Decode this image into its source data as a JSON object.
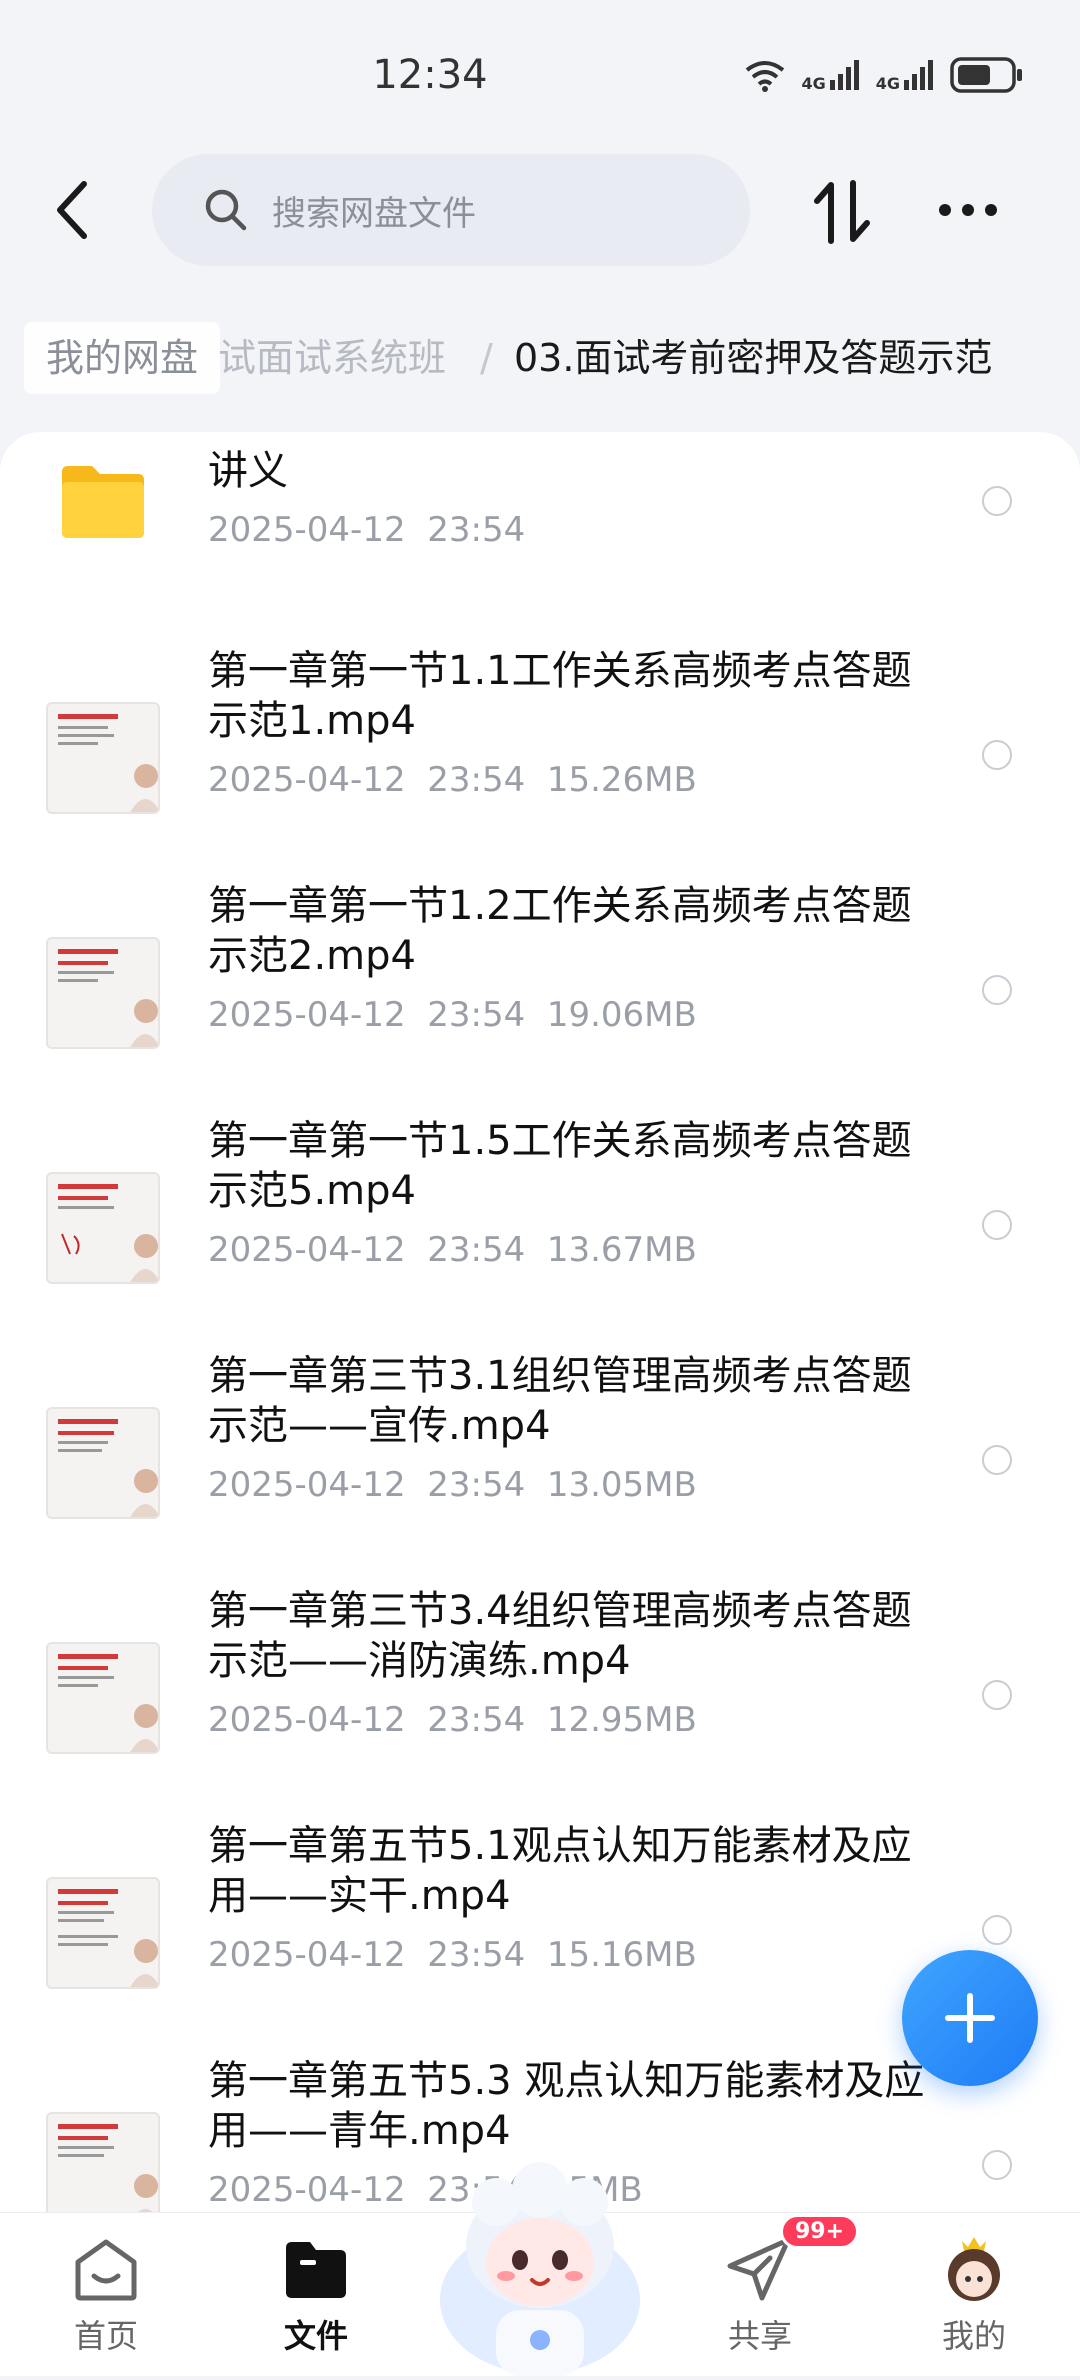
{
  "status": {
    "time": "12:34",
    "net1": "4G",
    "net2": "4G"
  },
  "search": {
    "placeholder": "搜索网盘文件"
  },
  "breadcrumb": {
    "root": "我的网盘",
    "middle": "试面试系统班",
    "separator": "/",
    "current": "03.面试考前密押及答题示范"
  },
  "files": [
    {
      "name": "讲义",
      "date": "2025-04-12",
      "time": "23:54",
      "size": "",
      "type": "folder"
    },
    {
      "name": "第一章第一节1.1工作关系高频考点答题示范1.mp4",
      "date": "2025-04-12",
      "time": "23:54",
      "size": "15.26MB",
      "type": "video"
    },
    {
      "name": "第一章第一节1.2工作关系高频考点答题示范2.mp4",
      "date": "2025-04-12",
      "time": "23:54",
      "size": "19.06MB",
      "type": "video"
    },
    {
      "name": "第一章第一节1.5工作关系高频考点答题示范5.mp4",
      "date": "2025-04-12",
      "time": "23:54",
      "size": "13.67MB",
      "type": "video"
    },
    {
      "name": "第一章第三节3.1组织管理高频考点答题示范——宣传.mp4",
      "date": "2025-04-12",
      "time": "23:54",
      "size": "13.05MB",
      "type": "video"
    },
    {
      "name": "第一章第三节3.4组织管理高频考点答题示范——消防演练.mp4",
      "date": "2025-04-12",
      "time": "23:54",
      "size": "12.95MB",
      "type": "video"
    },
    {
      "name": "第一章第五节5.1观点认知万能素材及应用——实干.mp4",
      "date": "2025-04-12",
      "time": "23:54",
      "size": "15.16MB",
      "type": "video"
    },
    {
      "name": "第一章第五节5.3 观点认知万能素材及应用——青年.mp4",
      "date": "2025-04-12",
      "time": "23:54",
      "size": "55MB",
      "type": "video"
    }
  ],
  "nav": {
    "home": "首页",
    "files": "文件",
    "share": "共享",
    "share_badge": "99+",
    "mine": "我的"
  },
  "colors": {
    "accent": "#1e7cf5",
    "badge": "#ff3b5c"
  }
}
